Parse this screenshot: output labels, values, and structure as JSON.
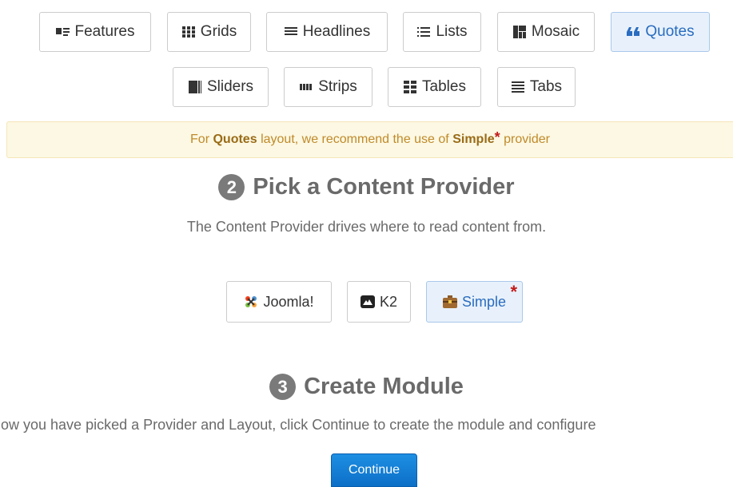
{
  "layouts": [
    {
      "label": "Features",
      "icon": "features-icon"
    },
    {
      "label": "Grids",
      "icon": "grids-icon"
    },
    {
      "label": "Headlines",
      "icon": "headlines-icon"
    },
    {
      "label": "Lists",
      "icon": "lists-icon"
    },
    {
      "label": "Mosaic",
      "icon": "mosaic-icon"
    },
    {
      "label": "Quotes",
      "icon": "quotes-icon",
      "active": true
    },
    {
      "label": "Sliders",
      "icon": "sliders-icon"
    },
    {
      "label": "Strips",
      "icon": "strips-icon"
    },
    {
      "label": "Tables",
      "icon": "tables-icon"
    },
    {
      "label": "Tabs",
      "icon": "tabs-icon"
    }
  ],
  "alert": {
    "prefix": "For",
    "layout": "Quotes",
    "middle": "layout, we recommend the use of",
    "provider": "Simple",
    "star": "*",
    "suffix": "provider"
  },
  "step2": {
    "number": "2",
    "title": "Pick a Content Provider",
    "description": "The Content Provider drives where to read content from."
  },
  "providers": [
    {
      "label": "Joomla!",
      "icon": "joomla-icon"
    },
    {
      "label": "K2",
      "icon": "k2-icon"
    },
    {
      "label": "Simple",
      "icon": "simple-icon",
      "active": true,
      "star": "*"
    }
  ],
  "step3": {
    "number": "3",
    "title": "Create Module",
    "description": "Now you have picked a Provider and Layout, click Continue to create the module and configure"
  },
  "continue_label": "Continue",
  "colors": {
    "accent": "#2a6cc0",
    "active_bg": "#e8f1fb",
    "alert_bg": "#fcf8e3",
    "star": "#c21b1b",
    "primary_button": "#1279d4"
  }
}
